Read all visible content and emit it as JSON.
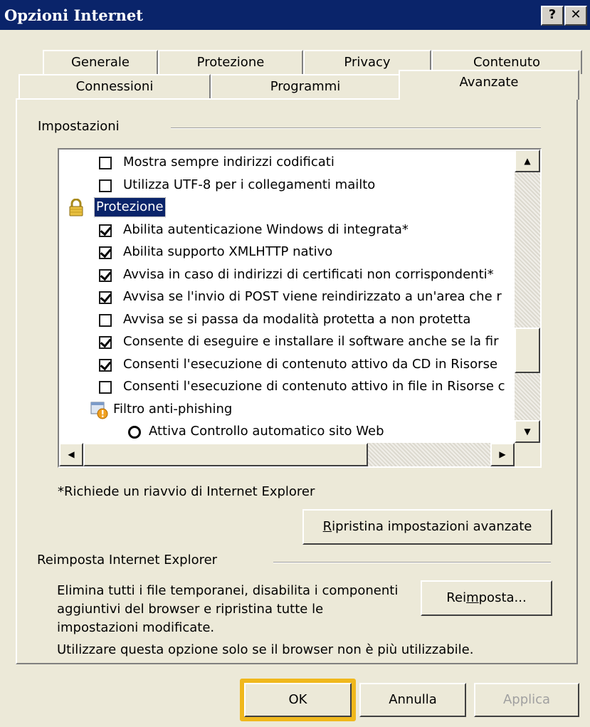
{
  "window": {
    "title": "Opzioni Internet",
    "help_label": "?",
    "close_label": "✕"
  },
  "tabs_row1": [
    "Generale",
    "Protezione",
    "Privacy",
    "Contenuto"
  ],
  "tabs_row2": [
    "Connessioni",
    "Programmi",
    "Avanzate"
  ],
  "active_tab": "Avanzate",
  "settings": {
    "group_label": "Impostazioni",
    "items": [
      {
        "type": "checkbox",
        "checked": false,
        "label": "Mostra sempre indirizzi codificati"
      },
      {
        "type": "checkbox",
        "checked": false,
        "label": "Utilizza UTF-8 per i collegamenti mailto"
      },
      {
        "type": "category",
        "icon": "lock-icon",
        "label": "Protezione"
      },
      {
        "type": "checkbox",
        "checked": true,
        "label": "Abilita autenticazione Windows di integrata*"
      },
      {
        "type": "checkbox",
        "checked": true,
        "label": "Abilita supporto XMLHTTP nativo"
      },
      {
        "type": "checkbox",
        "checked": true,
        "label": "Avvisa in caso di indirizzi di certificati non corrispondenti*"
      },
      {
        "type": "checkbox",
        "checked": true,
        "label": "Avvisa se l'invio di POST viene reindirizzato a un'area che r"
      },
      {
        "type": "checkbox",
        "checked": false,
        "label": "Avvisa se si passa da modalità protetta a non protetta"
      },
      {
        "type": "checkbox",
        "checked": true,
        "label": "Consente di eseguire e installare il software anche se la fir"
      },
      {
        "type": "checkbox",
        "checked": true,
        "label": "Consenti l'esecuzione di contenuto attivo da CD in Risorse"
      },
      {
        "type": "checkbox",
        "checked": false,
        "label": "Consenti l'esecuzione di contenuto attivo in file in Risorse c"
      },
      {
        "type": "category",
        "icon": "phishing-filter-icon",
        "label": "Filtro anti-phishing"
      },
      {
        "type": "radio",
        "checked": false,
        "label": "Attiva Controllo automatico sito Web"
      }
    ],
    "up_arrow": "▲",
    "down_arrow": "▼",
    "left_arrow": "◀",
    "right_arrow": "▶",
    "note": "*Richiede un riavvio di Internet Explorer",
    "restore_button": {
      "prefix": "",
      "underlined": "R",
      "rest": "ipristina impostazioni avanzate"
    }
  },
  "reset": {
    "group_label": "Reimposta Internet Explorer",
    "desc_lines": [
      "Elimina tutti i file temporanei, disabilita i componenti",
      "aggiuntivi del browser e ripristina tutte le",
      "impostazioni modificate."
    ],
    "note": "Utilizzare questa opzione solo se il browser non è più utilizzabile.",
    "button": {
      "prefix": "Rei",
      "underlined": "m",
      "rest": "posta..."
    }
  },
  "footer": {
    "ok": "OK",
    "cancel": "Annulla",
    "apply": "Applica"
  },
  "colors": {
    "title_bar": "#0a246a",
    "dialog_bg": "#ece9d8",
    "highlight": "#f0b81c",
    "selection": "#0a246a"
  }
}
